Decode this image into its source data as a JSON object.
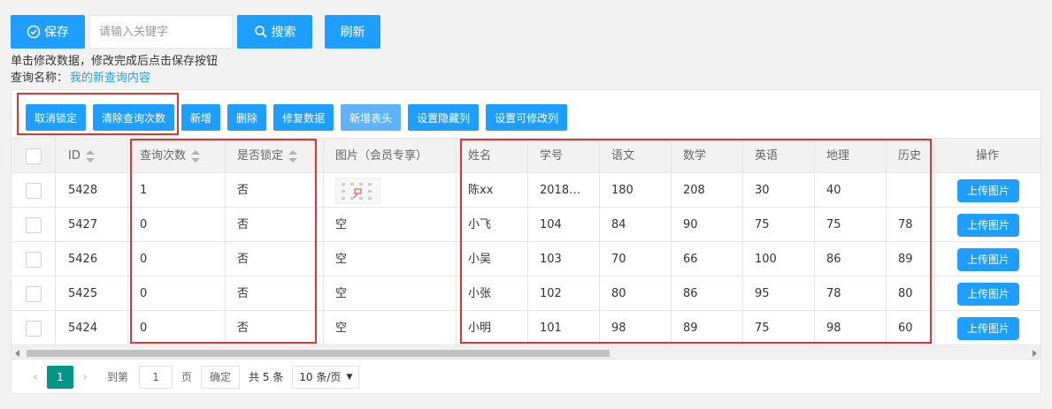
{
  "toolbar_top": {
    "save_label": "保存",
    "search_placeholder": "请输入关键字",
    "search_label": "搜索",
    "refresh_label": "刷新"
  },
  "hint_text": "单击修改数据，修改完成后点击保存按钮",
  "query": {
    "label": "查询名称：",
    "value": "我的新查询内容"
  },
  "table_toolbar": [
    "取消锁定",
    "清除查询次数",
    "新增",
    "删除",
    "修复数据",
    "新增表头",
    "设置隐藏列",
    "设置可修改列"
  ],
  "columns": [
    "ID",
    "查询次数",
    "是否锁定",
    "图片（会员专享）",
    "姓名",
    "学号",
    "语文",
    "数学",
    "英语",
    "地理",
    "历史",
    "操作"
  ],
  "rows": [
    [
      "5428",
      "1",
      "否",
      "",
      "陈xx",
      "2018…",
      "180",
      "208",
      "30",
      "40",
      "",
      "上传图片"
    ],
    [
      "5427",
      "0",
      "否",
      "空",
      "小飞",
      "104",
      "84",
      "90",
      "75",
      "75",
      "78",
      "上传图片"
    ],
    [
      "5426",
      "0",
      "否",
      "空",
      "小吴",
      "103",
      "70",
      "66",
      "100",
      "86",
      "89",
      "上传图片"
    ],
    [
      "5425",
      "0",
      "否",
      "空",
      "小张",
      "102",
      "80",
      "86",
      "95",
      "78",
      "80",
      "上传图片"
    ],
    [
      "5424",
      "0",
      "否",
      "空",
      "小明",
      "101",
      "98",
      "89",
      "75",
      "98",
      "60",
      "上传图片"
    ]
  ],
  "pager": {
    "current_page": "1",
    "goto_label": "到第",
    "goto_value": "1",
    "page_unit": "页",
    "confirm_label": "确定",
    "total_label": "共 5 条",
    "page_size_label": "10 条/页"
  },
  "colors": {
    "primary": "#1e9fff",
    "pager_active": "#009688",
    "highlight": "#e53333"
  }
}
